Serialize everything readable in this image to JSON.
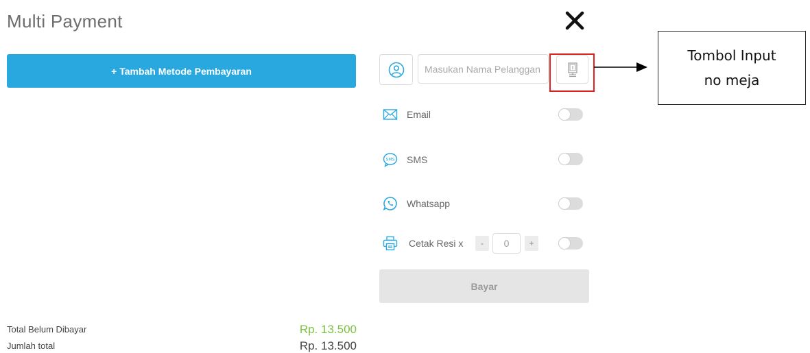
{
  "modal": {
    "title": "Multi Payment",
    "close_icon": "close-icon"
  },
  "add_payment_button": {
    "label": "+ Tambah Metode Pembayaran",
    "color": "#29a8e0"
  },
  "customer": {
    "user_icon": "user-icon",
    "name_placeholder": "Masukan Nama Pelanggan",
    "name_value": "",
    "table_icon": "table-number-icon"
  },
  "receipt_options": [
    {
      "label": "Email",
      "icon": "email-icon",
      "enabled": false
    },
    {
      "label": "SMS",
      "icon": "sms-icon",
      "enabled": false
    },
    {
      "label": "Whatsapp",
      "icon": "whatsapp-icon",
      "enabled": false
    }
  ],
  "print_receipt": {
    "label": "Cetak Resi x",
    "icon": "printer-icon",
    "minus_label": "-",
    "plus_label": "+",
    "quantity": "0",
    "enabled": false
  },
  "pay_button": {
    "label": "Bayar"
  },
  "summary": {
    "unpaid_label": "Total Belum Dibayar",
    "unpaid_value": "Rp. 13.500",
    "total_label": "Jumlah total",
    "total_value": "Rp. 13.500",
    "unpaid_color": "#7dc242"
  },
  "annotation": {
    "text": "Tombol Input no meja",
    "highlight_color": "#e02020"
  }
}
